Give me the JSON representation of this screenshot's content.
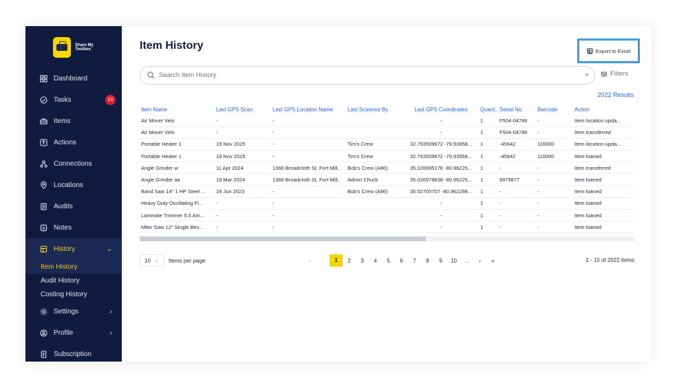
{
  "brand": {
    "logo_text": "Share My Toolbox"
  },
  "sidebar": {
    "items": [
      {
        "label": "Dashboard",
        "icon": "grid-icon"
      },
      {
        "label": "Tasks",
        "icon": "check-circle-icon",
        "badge": "19"
      },
      {
        "label": "Items",
        "icon": "box-icon"
      },
      {
        "label": "Actions",
        "icon": "actions-icon"
      },
      {
        "label": "Connections",
        "icon": "connections-icon"
      },
      {
        "label": "Locations",
        "icon": "pin-icon"
      },
      {
        "label": "Audits",
        "icon": "clipboard-icon"
      },
      {
        "label": "Notes",
        "icon": "note-icon"
      },
      {
        "label": "History",
        "icon": "history-icon",
        "chevron": "⌄"
      }
    ],
    "history_sub": [
      "Item History",
      "Audit History",
      "Costing History"
    ],
    "bottom_items": [
      {
        "label": "Settings",
        "icon": "gear-icon",
        "chevron": "›"
      },
      {
        "label": "Profile",
        "icon": "user-icon",
        "chevron": "›"
      },
      {
        "label": "Subscription",
        "icon": "receipt-icon"
      }
    ]
  },
  "header": {
    "title": "Item History",
    "export_label": "Export to Excel"
  },
  "search": {
    "placeholder": "Search Item History",
    "clear": "×",
    "filters_label": "Filters"
  },
  "results_label": "2022 Results",
  "table": {
    "columns": [
      "Item Name",
      "Last GPS Scan",
      "Last GPS Location Name",
      "Last Scanned By",
      "Last GPS Coordinates",
      "Quant...",
      "Serial No.",
      "Barcode",
      "Action"
    ],
    "rows": [
      [
        "Air Mover Velo",
        "-",
        "-",
        "",
        "-",
        "1",
        "F504-04786",
        "-",
        "Item location upda..."
      ],
      [
        "Air Mover Velo",
        "-",
        "-",
        "",
        "-",
        "1",
        "F504-04786",
        "-",
        "Item transferred"
      ],
      [
        "Portable Heater 1",
        "19 Nov 2025",
        "-",
        "Tim's Crew",
        "32.793509672 -79.93958...",
        "1",
        "-45642",
        "110000",
        "Item location upda..."
      ],
      [
        "Portable Heater 1",
        "19 Nov 2025",
        "-",
        "Tim's Crew",
        "32.793509672 -79.93958...",
        "1",
        "-45642",
        "110000",
        "Item loaned"
      ],
      [
        "Angle Grinder w",
        "11 Apr 2024",
        "1366 Broadcloth St, Fort Mill,",
        "Bob's Crew (A86)",
        "35.026995178 -80.96225...",
        "1",
        "-",
        "-",
        "Item transferred"
      ],
      [
        "Angle Grinder aa",
        "19 Mar 2024",
        "1366 Broadcloth St, Fort Mill,",
        "Admin Chuck",
        "35.026978838 -80.96225...",
        "1",
        "8979877",
        "-",
        "Item loaned"
      ],
      [
        "Band Saw 14\" 1 HP Steel ...",
        "19 Jun 2023",
        "-",
        "Bob's Crew (A86)",
        "35.02700707 -80.962298...",
        "1",
        "-",
        "-",
        "Item loaned"
      ],
      [
        "Heavy Duty Oscillating Fl...",
        "-",
        "-",
        "",
        "-",
        "1",
        "-",
        "-",
        "Item loaned"
      ],
      [
        "Laminate Trimmer 5.6 Am...",
        "-",
        "-",
        "",
        "-",
        "1",
        "-",
        "-",
        "Item loaned"
      ],
      [
        "Miter Saw 12\" Single Bev...",
        "-",
        "-",
        "",
        "-",
        "1",
        "-",
        "-",
        "Item loaned"
      ]
    ]
  },
  "pagination": {
    "page_size": "10",
    "items_per_page_label": "Items per page",
    "first": "«",
    "prev": "‹",
    "pages": [
      "1",
      "2",
      "3",
      "4",
      "5",
      "6",
      "7",
      "8",
      "9",
      "10",
      "..."
    ],
    "current": "1",
    "next": "›",
    "last": "»",
    "range_label": "1 - 10 of 2022 items"
  },
  "colors": {
    "sidebar": "#0f1c3f",
    "accent": "#f7d600",
    "link": "#2563eb",
    "highlight": "#3b9de6"
  }
}
